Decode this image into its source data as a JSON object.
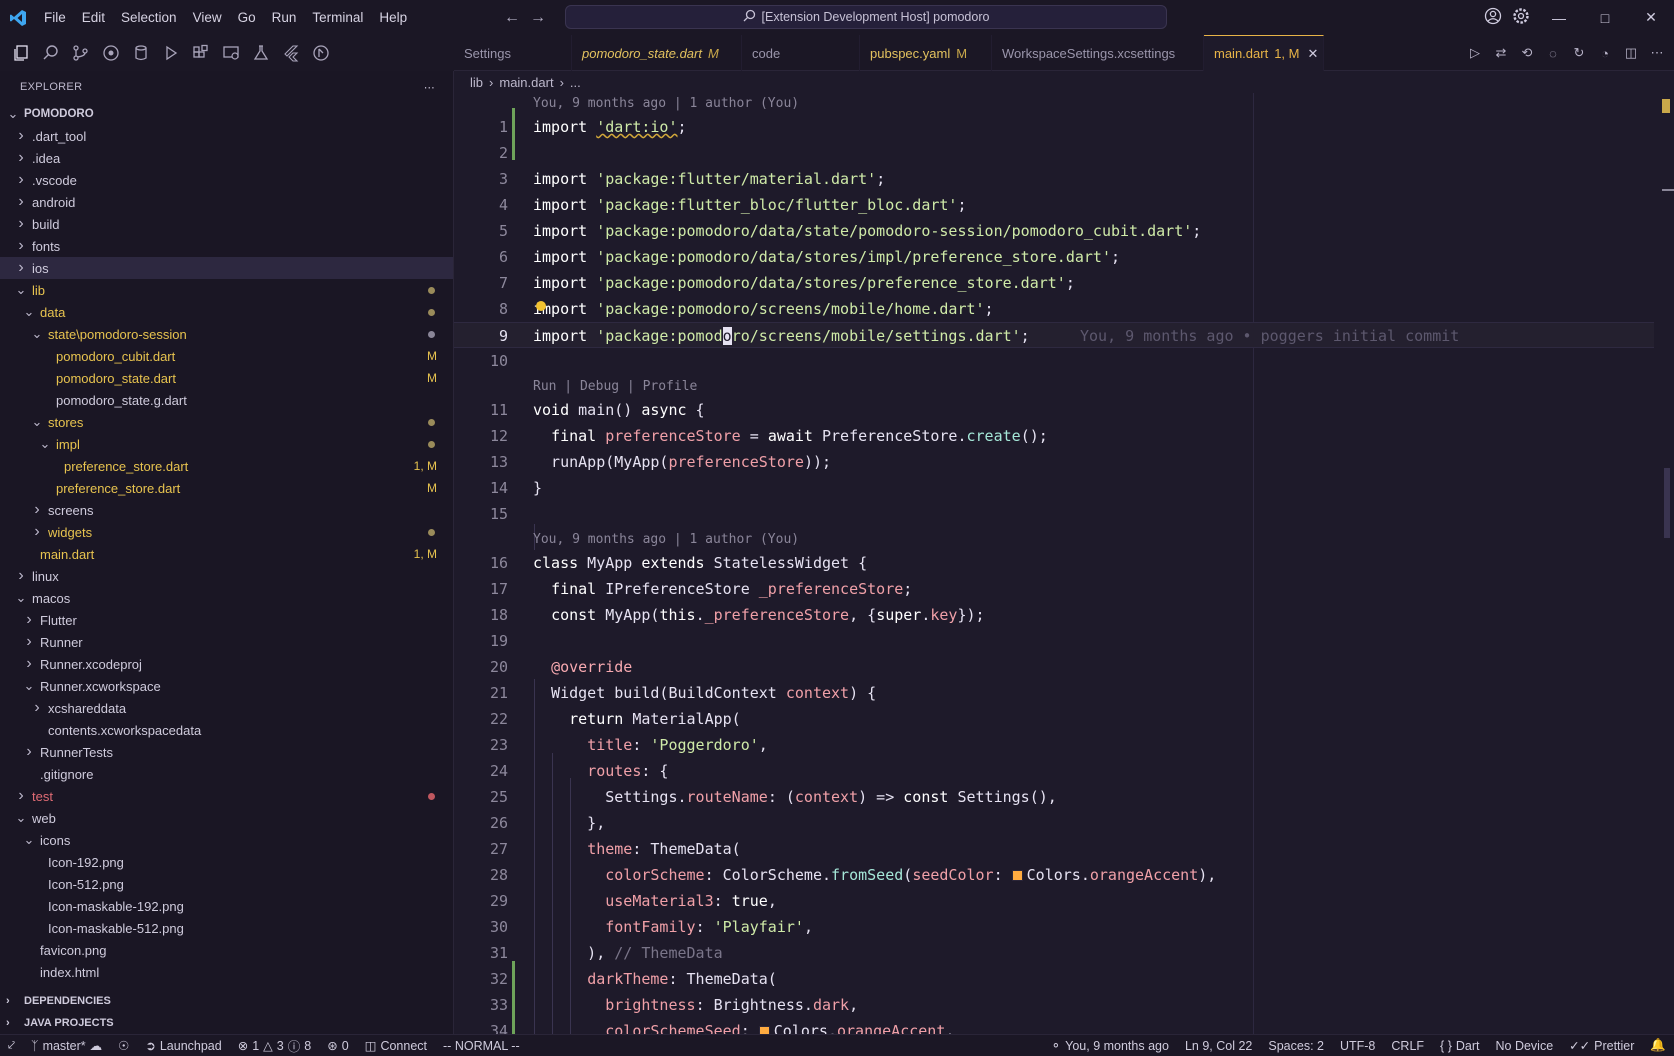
{
  "titlebar": {
    "menus": [
      "File",
      "Edit",
      "Selection",
      "View",
      "Go",
      "Run",
      "Terminal",
      "Help"
    ],
    "search_text": "[Extension Development Host] pomodoro"
  },
  "tabs": [
    {
      "label": "Settings",
      "badge": ""
    },
    {
      "label": "pomodoro_state.dart",
      "badge": "M"
    },
    {
      "label": "code",
      "badge": ""
    },
    {
      "label": "pubspec.yaml",
      "badge": "M"
    },
    {
      "label": "WorkspaceSettings.xcsettings",
      "badge": ""
    },
    {
      "label": "main.dart",
      "badge": "1, M"
    }
  ],
  "sidebar": {
    "title": "EXPLORER",
    "root": "POMODORO",
    "tree": [
      {
        "label": ".dart_tool",
        "depth": 1,
        "chev": "right"
      },
      {
        "label": ".idea",
        "depth": 1,
        "chev": "right"
      },
      {
        "label": ".vscode",
        "depth": 1,
        "chev": "right"
      },
      {
        "label": "android",
        "depth": 1,
        "chev": "right"
      },
      {
        "label": "build",
        "depth": 1,
        "chev": "right"
      },
      {
        "label": "fonts",
        "depth": 1,
        "chev": "right"
      },
      {
        "label": "ios",
        "depth": 1,
        "chev": "right"
      },
      {
        "label": "lib",
        "depth": 1,
        "chev": "down"
      },
      {
        "label": "data",
        "depth": 2,
        "chev": "down"
      },
      {
        "label": "state\\pomodoro-session",
        "depth": 3,
        "chev": "down"
      },
      {
        "label": "pomodoro_cubit.dart",
        "depth": 4,
        "chev": "",
        "badge": "M"
      },
      {
        "label": "pomodoro_state.dart",
        "depth": 4,
        "chev": "",
        "badge": "M"
      },
      {
        "label": "pomodoro_state.g.dart",
        "depth": 4,
        "chev": ""
      },
      {
        "label": "stores",
        "depth": 3,
        "chev": "down"
      },
      {
        "label": "impl",
        "depth": 4,
        "chev": "down"
      },
      {
        "label": "preference_store.dart",
        "depth": 5,
        "chev": "",
        "badge": "1, M"
      },
      {
        "label": "preference_store.dart",
        "depth": 4,
        "chev": "",
        "badge": "M"
      },
      {
        "label": "screens",
        "depth": 3,
        "chev": "right"
      },
      {
        "label": "widgets",
        "depth": 3,
        "chev": "right"
      },
      {
        "label": "main.dart",
        "depth": 2,
        "chev": "",
        "badge": "1, M"
      },
      {
        "label": "linux",
        "depth": 1,
        "chev": "right"
      },
      {
        "label": "macos",
        "depth": 1,
        "chev": "down"
      },
      {
        "label": "Flutter",
        "depth": 2,
        "chev": "right"
      },
      {
        "label": "Runner",
        "depth": 2,
        "chev": "right"
      },
      {
        "label": "Runner.xcodeproj",
        "depth": 2,
        "chev": "right"
      },
      {
        "label": "Runner.xcworkspace",
        "depth": 2,
        "chev": "down"
      },
      {
        "label": "xcshareddata",
        "depth": 3,
        "chev": "right"
      },
      {
        "label": "contents.xcworkspacedata",
        "depth": 3,
        "chev": ""
      },
      {
        "label": "RunnerTests",
        "depth": 2,
        "chev": "right"
      },
      {
        "label": ".gitignore",
        "depth": 2,
        "chev": ""
      },
      {
        "label": "test",
        "depth": 1,
        "chev": "right"
      },
      {
        "label": "web",
        "depth": 1,
        "chev": "down"
      },
      {
        "label": "icons",
        "depth": 2,
        "chev": "down"
      },
      {
        "label": "Icon-192.png",
        "depth": 3,
        "chev": ""
      },
      {
        "label": "Icon-512.png",
        "depth": 3,
        "chev": ""
      },
      {
        "label": "Icon-maskable-192.png",
        "depth": 3,
        "chev": ""
      },
      {
        "label": "Icon-maskable-512.png",
        "depth": 3,
        "chev": ""
      },
      {
        "label": "favicon.png",
        "depth": 2,
        "chev": ""
      },
      {
        "label": "index.html",
        "depth": 2,
        "chev": ""
      }
    ],
    "sections": [
      "DEPENDENCIES",
      "JAVA PROJECTS"
    ]
  },
  "breadcrumb": [
    "lib",
    "main.dart",
    "..."
  ],
  "editor": {
    "blame_top": "You, 9 months ago | 1 author (You)",
    "codelens_run": "Run | Debug | Profile",
    "blame_class": "You, 9 months ago | 1 author (You)",
    "inline_blame": "You, 9 months ago • poggers initial commit",
    "line_numbers": [
      "1",
      "2",
      "3",
      "4",
      "5",
      "6",
      "7",
      "8",
      "9",
      "10",
      "11",
      "12",
      "13",
      "14",
      "15",
      "16",
      "17",
      "18",
      "19",
      "20",
      "21",
      "22",
      "23",
      "24",
      "25",
      "26",
      "27",
      "28",
      "29",
      "30",
      "31",
      "32",
      "33",
      "34"
    ],
    "lines": [
      "import 'dart:io';",
      "",
      "import 'package:flutter/material.dart';",
      "import 'package:flutter_bloc/flutter_bloc.dart';",
      "import 'package:pomodoro/data/state/pomodoro-session/pomodoro_cubit.dart';",
      "import 'package:pomodoro/data/stores/impl/preference_store.dart';",
      "import 'package:pomodoro/data/stores/preference_store.dart';",
      "import 'package:pomodoro/screens/mobile/home.dart';",
      "import 'package:pomodoro/screens/mobile/settings.dart';",
      "",
      "void main() async {",
      "  final preferenceStore = await PreferenceStore.create();",
      "  runApp(MyApp(preferenceStore));",
      "}",
      "",
      "class MyApp extends StatelessWidget {",
      "  final IPreferenceStore _preferenceStore;",
      "  const MyApp(this._preferenceStore, {super.key});",
      "",
      "  @override",
      "  Widget build(BuildContext context) {",
      "    return MaterialApp(",
      "      title: 'Poggerdoro',",
      "      routes: {",
      "        Settings.routeName: (context) => const Settings(),",
      "      },",
      "      theme: ThemeData(",
      "        colorScheme: ColorScheme.fromSeed(seedColor: Colors.orangeAccent),",
      "        useMaterial3: true,",
      "        fontFamily: 'Playfair',",
      "      ), // ThemeData",
      "      darkTheme: ThemeData(",
      "        brightness: Brightness.dark,",
      "        colorSchemeSeed: Colors.orangeAccent,"
    ]
  },
  "statusbar": {
    "branch": "master*",
    "launchpad": "Launchpad",
    "problems": "1",
    "warnings": "3",
    "infos": "8",
    "ports": "0",
    "connect": "Connect",
    "mode": "-- NORMAL --",
    "blame": "You, 9 months ago",
    "position": "Ln 9, Col 22",
    "spaces": "Spaces: 2",
    "encoding": "UTF-8",
    "eol": "CRLF",
    "language": "Dart",
    "device": "No Device",
    "formatter": "Prettier"
  },
  "colors": {
    "accent": "#e8b447",
    "modified": "#e7c34f",
    "error": "#e06b74",
    "editor_bg": "#1e1a2a"
  }
}
